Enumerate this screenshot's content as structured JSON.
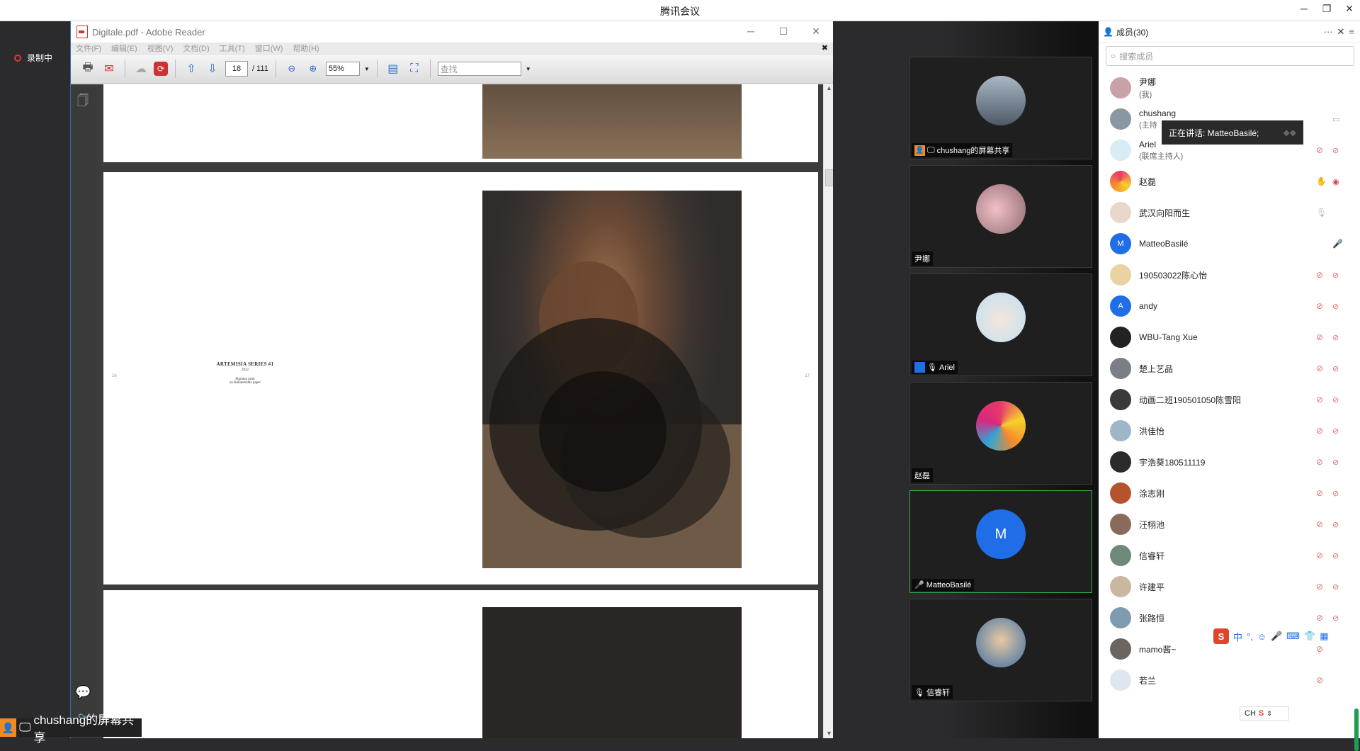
{
  "app_title": "腾讯会议",
  "recording_label": "录制中",
  "share_badge": "chushang的屏幕共享",
  "reader": {
    "title": "Digitale.pdf - Adobe Reader",
    "menu": [
      "文件(F)",
      "编辑(E)",
      "视图(V)",
      "文档(D)",
      "工具(T)",
      "窗口(W)",
      "帮助(H)"
    ],
    "page_current": "18",
    "page_total": "/ 111",
    "zoom": "55%",
    "find_placeholder": "查找",
    "caption_title": "ARTEMISIA SERIES #1",
    "caption_year": "2022",
    "caption_line1": "Pigment print",
    "caption_line2": "on Hahnemühle paper",
    "page_mark_left": "16",
    "page_mark_right": "17"
  },
  "video_tiles": [
    {
      "name": "chushang的屏幕共享"
    },
    {
      "name": "尹娜"
    },
    {
      "name": "Ariel"
    },
    {
      "name": "赵磊"
    },
    {
      "name": "MatteoBasilé",
      "initial": "M"
    },
    {
      "name": "信睿轩"
    }
  ],
  "members": {
    "title": "成员(30)",
    "search_placeholder": "搜索成员",
    "tooltip": "正在讲话: MatteoBasilé;",
    "list": [
      {
        "name": "尹娜",
        "sub": "(我)"
      },
      {
        "name": "chushang",
        "sub": "(主持"
      },
      {
        "name": "Ariel",
        "sub": "(联席主持人)"
      },
      {
        "name": "赵磊"
      },
      {
        "name": "武汉向阳而生"
      },
      {
        "name": "MatteoBasilé",
        "initial": "M"
      },
      {
        "name": "190503022陈心怡"
      },
      {
        "name": "andy",
        "initial": "A"
      },
      {
        "name": "WBU-Tang Xue"
      },
      {
        "name": "楚上艺品"
      },
      {
        "name": "动画二班190501050陈雪阳"
      },
      {
        "name": "洪佳怡"
      },
      {
        "name": "宇浩葵180511119"
      },
      {
        "name": "涂志刚"
      },
      {
        "name": "汪栩池"
      },
      {
        "name": "信睿轩"
      },
      {
        "name": "许建平"
      },
      {
        "name": "张路恒"
      },
      {
        "name": "mamo酱~"
      },
      {
        "name": "若兰"
      }
    ]
  },
  "ime": {
    "lang": "中",
    "bar": "CH"
  }
}
